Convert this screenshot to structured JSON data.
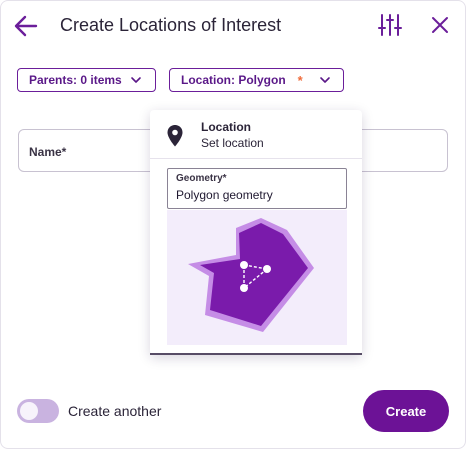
{
  "header": {
    "title": "Create Locations of Interest",
    "back_icon": "arrow-left-icon",
    "settings_icon": "sliders-icon",
    "close_icon": "close-icon"
  },
  "filters": {
    "parents_label": "Parents: 0 items",
    "location_label": "Location: Polygon",
    "location_required_marker": "*"
  },
  "name_field": {
    "label": "Name*"
  },
  "popover": {
    "title": "Location",
    "subtitle": "Set location",
    "geometry_label": "Geometry*",
    "geometry_value": "Polygon geometry",
    "icon": "map-pin-icon"
  },
  "footer": {
    "toggle_label": "Create another",
    "toggle_on": false,
    "create_label": "Create"
  },
  "colors": {
    "accent": "#6c1296",
    "polygon_fill": "#7a1bab",
    "polygon_outline": "#c58de6",
    "required": "#ef6b3a"
  }
}
